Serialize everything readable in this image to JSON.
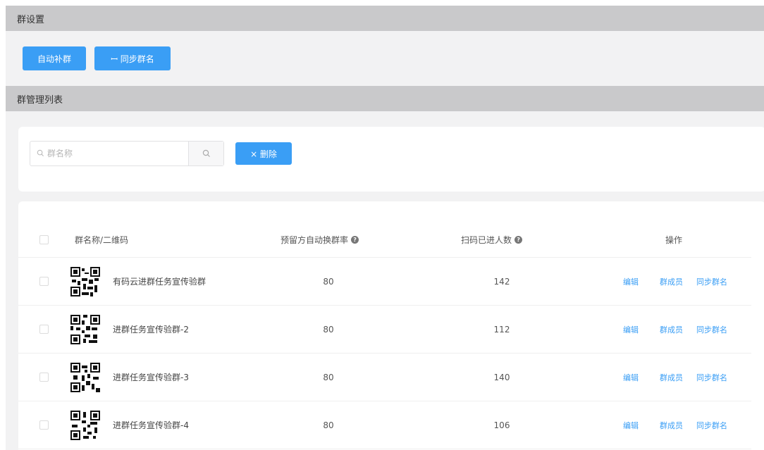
{
  "sections": {
    "settings_title": "群设置",
    "list_title": "群管理列表"
  },
  "toolbar": {
    "button1_label": "自动补群",
    "button2_label": "ꟷ 同步群名"
  },
  "search": {
    "placeholder": "群名称",
    "delete_label": "× 删除"
  },
  "table": {
    "headers": {
      "qr": "群名称/二维码",
      "threshold": "预留方自动换群率",
      "count": "扫码已进人数",
      "actions": "操作"
    },
    "action_labels": {
      "edit": "编辑",
      "group_qr": "群成员",
      "sync": "同步群名"
    },
    "rows": [
      {
        "name": "有码云进群任务宣传验群",
        "threshold": "80",
        "count": "142"
      },
      {
        "name": "进群任务宣传验群-2",
        "threshold": "80",
        "count": "112"
      },
      {
        "name": "进群任务宣传验群-3",
        "threshold": "80",
        "count": "140"
      },
      {
        "name": "进群任务宣传验群-4",
        "threshold": "80",
        "count": "106"
      }
    ]
  },
  "colors": {
    "accent": "#3a9ef5",
    "header_bar": "#c9c9cb",
    "background": "#f2f2f3"
  }
}
